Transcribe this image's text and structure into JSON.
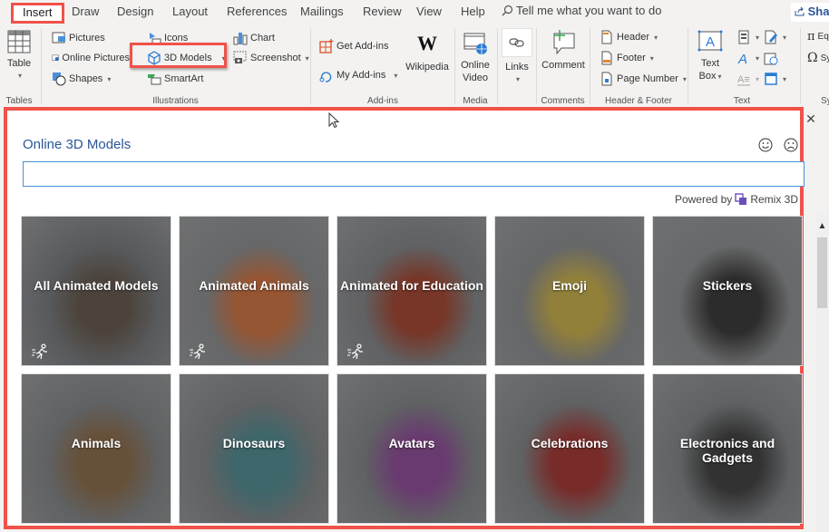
{
  "tabs": [
    {
      "label": "Insert",
      "active": true
    },
    {
      "label": "Draw"
    },
    {
      "label": "Design"
    },
    {
      "label": "Layout"
    },
    {
      "label": "References"
    },
    {
      "label": "Mailings"
    },
    {
      "label": "Review"
    },
    {
      "label": "View"
    },
    {
      "label": "Help"
    }
  ],
  "tell_me": "Tell me what you want to do",
  "share_label": "Share",
  "ribbon": {
    "tables": {
      "table": "Table",
      "group": "Tables"
    },
    "illustrations": {
      "pictures": "Pictures",
      "online_pictures": "Online Pictures",
      "shapes": "Shapes",
      "icons": "Icons",
      "models_3d": "3D Models",
      "smartart": "SmartArt",
      "chart": "Chart",
      "screenshot": "Screenshot",
      "group": "Illustrations"
    },
    "addins": {
      "get": "Get Add-ins",
      "my": "My Add-ins",
      "wikipedia": "Wikipedia",
      "group": "Add-ins"
    },
    "media": {
      "online_video_1": "Online",
      "online_video_2": "Video",
      "group": "Media"
    },
    "links": {
      "label": "Links"
    },
    "comments": {
      "comment": "Comment",
      "group": "Comments"
    },
    "header_footer": {
      "header": "Header",
      "footer": "Footer",
      "page_number": "Page Number",
      "group": "Header & Footer"
    },
    "text": {
      "textbox_1": "Text",
      "textbox_2": "Box",
      "group": "Text"
    },
    "symbols": {
      "equation": "Equation",
      "symbol": "Symbol",
      "group": "Symbols"
    }
  },
  "dialog": {
    "title": "Online 3D Models",
    "search_value": "",
    "search_placeholder": "",
    "powered_by": "Powered by",
    "provider": "Remix 3D",
    "close_icon": "close-icon",
    "tiles": [
      {
        "label": "All Animated Models",
        "animated": true,
        "colors": [
          "#6f7378",
          "#5a4a3c"
        ]
      },
      {
        "label": "Animated Animals",
        "animated": true,
        "colors": [
          "#8a8c8e",
          "#e06a2a"
        ]
      },
      {
        "label": "Animated for Education",
        "animated": true,
        "colors": [
          "#7e8083",
          "#a83218"
        ]
      },
      {
        "label": "Emoji",
        "animated": false,
        "colors": [
          "#888a8c",
          "#d8b83a"
        ]
      },
      {
        "label": "Stickers",
        "animated": false,
        "colors": [
          "#8c8e90",
          "#202020"
        ]
      },
      {
        "label": "Animals",
        "animated": false,
        "colors": [
          "#7d8184",
          "#8a6238"
        ]
      },
      {
        "label": "Dinosaurs",
        "animated": false,
        "colors": [
          "#7d8184",
          "#3f8a92"
        ]
      },
      {
        "label": "Avatars",
        "animated": false,
        "colors": [
          "#7d8184",
          "#8e3a9a"
        ]
      },
      {
        "label": "Celebrations",
        "animated": false,
        "colors": [
          "#7d8184",
          "#a8201c"
        ]
      },
      {
        "label": "Electronics and Gadgets",
        "animated": false,
        "colors": [
          "#7d8184",
          "#2a2a2a"
        ]
      }
    ]
  }
}
